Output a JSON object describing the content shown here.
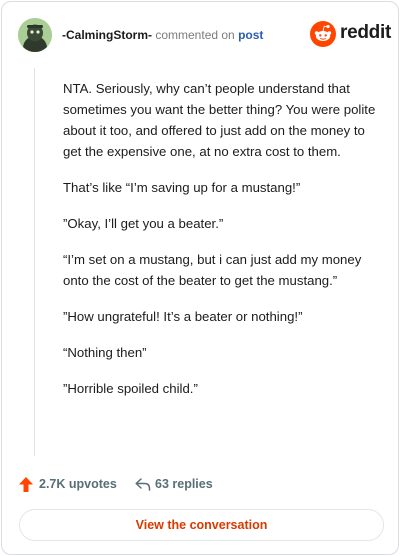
{
  "header": {
    "username": "-CalmingStorm-",
    "action_text": "commented on",
    "post_link": "post",
    "brand": "reddit"
  },
  "comment": {
    "paragraphs": [
      "NTA. Seriously, why can’t people understand that sometimes you want the better thing? You were polite about it too, and offered to just add on the money to get the expensive one, at no extra cost to them.",
      "That’s like “I’m saving up for a mustang!”",
      "”Okay, I’ll get you a beater.”",
      "“I’m set on a mustang, but i can just add my money onto the cost of the beater to get the mustang.”",
      "”How ungrateful! It’s a beater or nothing!”",
      "“Nothing then”",
      "”Horrible spoiled child.”"
    ]
  },
  "actions": {
    "upvotes": "2.7K upvotes",
    "replies": "63 replies"
  },
  "footer": {
    "view_label": "View the conversation"
  },
  "colors": {
    "brand_orange": "#ff4500",
    "link_blue": "#2a5db0",
    "cta_red": "#d93a00"
  },
  "icons": [
    "avatar",
    "reddit-logo-icon",
    "upvote-arrow-icon",
    "reply-arrow-icon"
  ]
}
